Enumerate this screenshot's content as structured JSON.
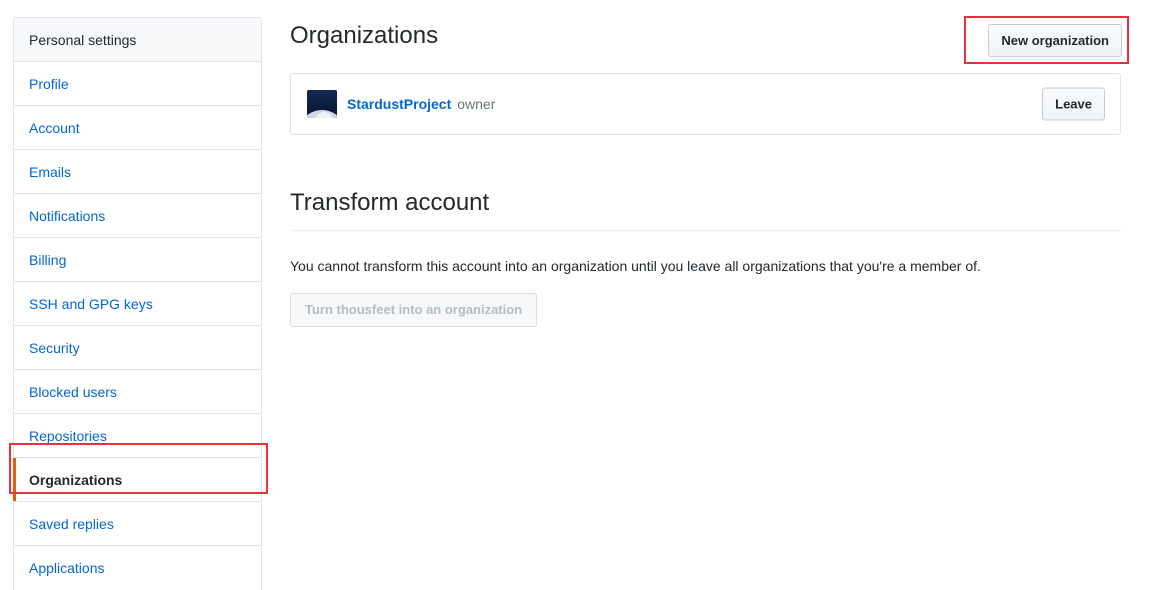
{
  "sidebar": {
    "header": "Personal settings",
    "items": [
      {
        "label": "Profile",
        "selected": false
      },
      {
        "label": "Account",
        "selected": false
      },
      {
        "label": "Emails",
        "selected": false
      },
      {
        "label": "Notifications",
        "selected": false
      },
      {
        "label": "Billing",
        "selected": false
      },
      {
        "label": "SSH and GPG keys",
        "selected": false
      },
      {
        "label": "Security",
        "selected": false
      },
      {
        "label": "Blocked users",
        "selected": false
      },
      {
        "label": "Repositories",
        "selected": false
      },
      {
        "label": "Organizations",
        "selected": true
      },
      {
        "label": "Saved replies",
        "selected": false
      },
      {
        "label": "Applications",
        "selected": false
      }
    ],
    "selected_item": "Organizations",
    "selected_accent_color": "#e36209",
    "link_color": "#0366d6",
    "header_background": "#f6f8fa"
  },
  "main": {
    "page_title": "Organizations",
    "new_organization_button": "New organization",
    "organizations": [
      {
        "name": "StardustProject",
        "role": "owner",
        "avatar_icon": "stardust-avatar-image",
        "leave_button": "Leave"
      }
    ],
    "transform_section": {
      "title": "Transform account",
      "note": "You cannot transform this account into an organization until you leave all organizations that you're a member of.",
      "disabled_button": "Turn thousfeet into an organization"
    }
  },
  "annotations": {
    "color": "#e8313a",
    "highlights": [
      "new-organization-button",
      "sidebar-item-organizations"
    ]
  }
}
